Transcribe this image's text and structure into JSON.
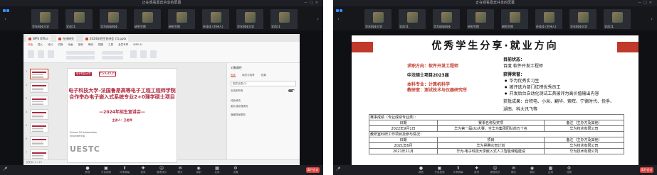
{
  "left_window": {
    "title": "正在观看嘉宾共享的屏幕",
    "participants": [
      {
        "name": "华东科技大学"
      },
      {
        "name": "学员11"
      },
      {
        "name": "华为机电科技"
      },
      {
        "name": "研究生院"
      },
      {
        "name": "研究生院"
      },
      {
        "name": "孙佳佳 (主持人)"
      },
      {
        "name": "华东科技大学"
      },
      {
        "name": "学员11"
      }
    ],
    "ppt": {
      "tabs": [
        "WPS Office",
        "在线研究",
        "2024年招生宣讲会 (1).pptx"
      ],
      "menu": [
        "开始",
        "插入",
        "设计",
        "切换",
        "动画",
        "放映",
        "审阅",
        "视图",
        "工具",
        "会员专享",
        "WPS AI"
      ],
      "menu_active": "开始",
      "thumb_numbers": [
        "1",
        "2",
        "3",
        "4",
        "5",
        "6",
        "7"
      ],
      "slide": {
        "logo_text": "电子科技大学",
        "logo2_text": "ESIGELEC",
        "title_line1": "电子科技大学–法国鲁昂高等电子工程工程师学院",
        "title_line2": "合作举办电子嵌入式系统专业2+0理学硕士项目",
        "subtitle": "—2024年招生宣讲会—",
        "presenter": "主讲人：卫老师",
        "school_line1": "School Of Automation",
        "school_line2": "Engineering",
        "watermark": "UESTC"
      },
      "side_panel": {
        "heading": "对象属性",
        "tabs": [
          "形状",
          "填充与线条",
          "效果"
        ],
        "rows": [
          "图层设置(G)",
          "应用到所有",
          "纯色填充",
          "图片或纹理填充",
          "隐藏背景图形"
        ]
      },
      "status": "幻灯片 1 / 13"
    },
    "toolbar": {
      "items": [
        "静音",
        "开启视频",
        "共享屏幕",
        "邀请",
        "管理成员",
        "聊天",
        "录制",
        "应用",
        "设置"
      ],
      "end_label": "离开会议"
    }
  },
  "right_window": {
    "title": "正在观看嘉宾共享的屏幕",
    "participants": [
      {
        "name": "华东科技大学"
      },
      {
        "name": "学员11"
      },
      {
        "name": "华为机电科技"
      },
      {
        "name": "研究生院"
      },
      {
        "name": "研究生院"
      },
      {
        "name": "孙佳佳 (主持人)"
      },
      {
        "name": "华东科技大学"
      },
      {
        "name": "学员11"
      }
    ],
    "slide": {
      "title": "优秀学生分享·就业方向",
      "left_lines": [
        {
          "text": "求职方向：软件开发工程师",
          "color": "red"
        },
        {
          "text": "中法硕士项目2023届",
          "color": "black"
        },
        {
          "text": "本科专业：计算机科学",
          "color": "red"
        },
        {
          "text": "教研室：测试技术与仪器研究所",
          "color": "red"
        }
      ],
      "status_heading": "目前状态：",
      "status_text": "百度 软件开发工程师",
      "honors_heading": "获得荣誉：",
      "honors": [
        "华为优秀实习生",
        "被评选为部门红榜优秀员工",
        "开发后台自动化测试工具被评为高价值输出内容"
      ],
      "offers_line1": "获批成果：台积电、小米、翻华、紫晖、宁德时代、快手、",
      "offers_line2": "湖南、科大讯飞等",
      "table": {
        "section1": "赛事成绩（专业成绩专业类）：",
        "header1": [
          "日期",
          "赛事名称及奖项",
          "备注（主办方及其他）"
        ],
        "rows1": [
          [
            "2022年9月1日",
            "华为第一届cto大赛，全华为集团团队前五十名",
            "华为技术有限公司"
          ]
        ],
        "section2": "教研室科研工作项目及参与情况：",
        "header2": [
          "日期",
          "项目",
          "备注（主办方及其他）"
        ],
        "rows2": [
          [
            "2021年6月",
            "华为昇腾众智计划",
            "华为技术有限公司"
          ],
          [
            "2021年11月",
            "华为-电子科技大学嵌入式人工智能课程建设",
            "华为技术有限公司"
          ]
        ]
      }
    },
    "toolbar": {
      "items": [
        "静音",
        "开启视频",
        "共享屏幕",
        "邀请",
        "管理成员",
        "聊天",
        "录制",
        "应用",
        "设置"
      ],
      "end_label": "离开会议"
    }
  }
}
